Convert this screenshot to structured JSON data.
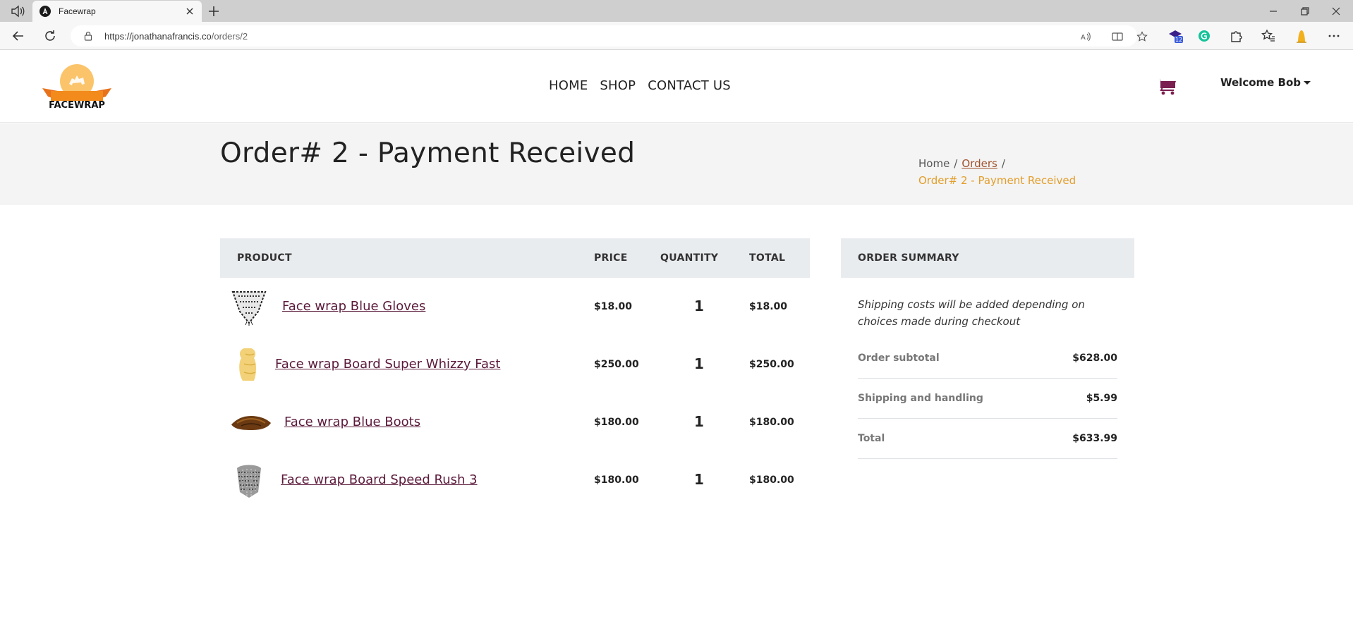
{
  "browser": {
    "tab_title": "Facewrap",
    "url_host": "https://jonathanafrancis.co",
    "url_path": "/orders/2",
    "extension_badge": "12"
  },
  "header": {
    "logo_text": "FACEWRAP",
    "nav": [
      {
        "label": "HOME"
      },
      {
        "label": "SHOP"
      },
      {
        "label": "CONTACT US"
      }
    ],
    "user_menu": "Welcome Bob"
  },
  "page": {
    "title": "Order# 2 - Payment Received",
    "breadcrumb": {
      "home": "Home",
      "orders": "Orders",
      "current": "Order# 2 - Payment Received"
    }
  },
  "table": {
    "headers": {
      "product": "PRODUCT",
      "price": "PRICE",
      "quantity": "QUANTITY",
      "total": "TOTAL"
    },
    "rows": [
      {
        "name": "Face wrap Blue Gloves",
        "price": "$18.00",
        "qty": "1",
        "total": "$18.00"
      },
      {
        "name": "Face wrap Board Super Whizzy Fast",
        "price": "$250.00",
        "qty": "1",
        "total": "$250.00"
      },
      {
        "name": "Face wrap Blue Boots",
        "price": "$180.00",
        "qty": "1",
        "total": "$180.00"
      },
      {
        "name": "Face wrap Board Speed Rush 3",
        "price": "$180.00",
        "qty": "1",
        "total": "$180.00"
      }
    ]
  },
  "summary": {
    "title": "ORDER SUMMARY",
    "note": "Shipping costs will be added depending on choices made during checkout",
    "subtotal_label": "Order subtotal",
    "subtotal_value": "$628.00",
    "shipping_label": "Shipping and handling",
    "shipping_value": "$5.99",
    "total_label": "Total",
    "total_value": "$633.99"
  },
  "colors": {
    "product_link": "#5b1a3b",
    "breadcrumb_active": "#e39e2b",
    "cart": "#7a1f4f",
    "logo_orange": "#f39c1f"
  }
}
